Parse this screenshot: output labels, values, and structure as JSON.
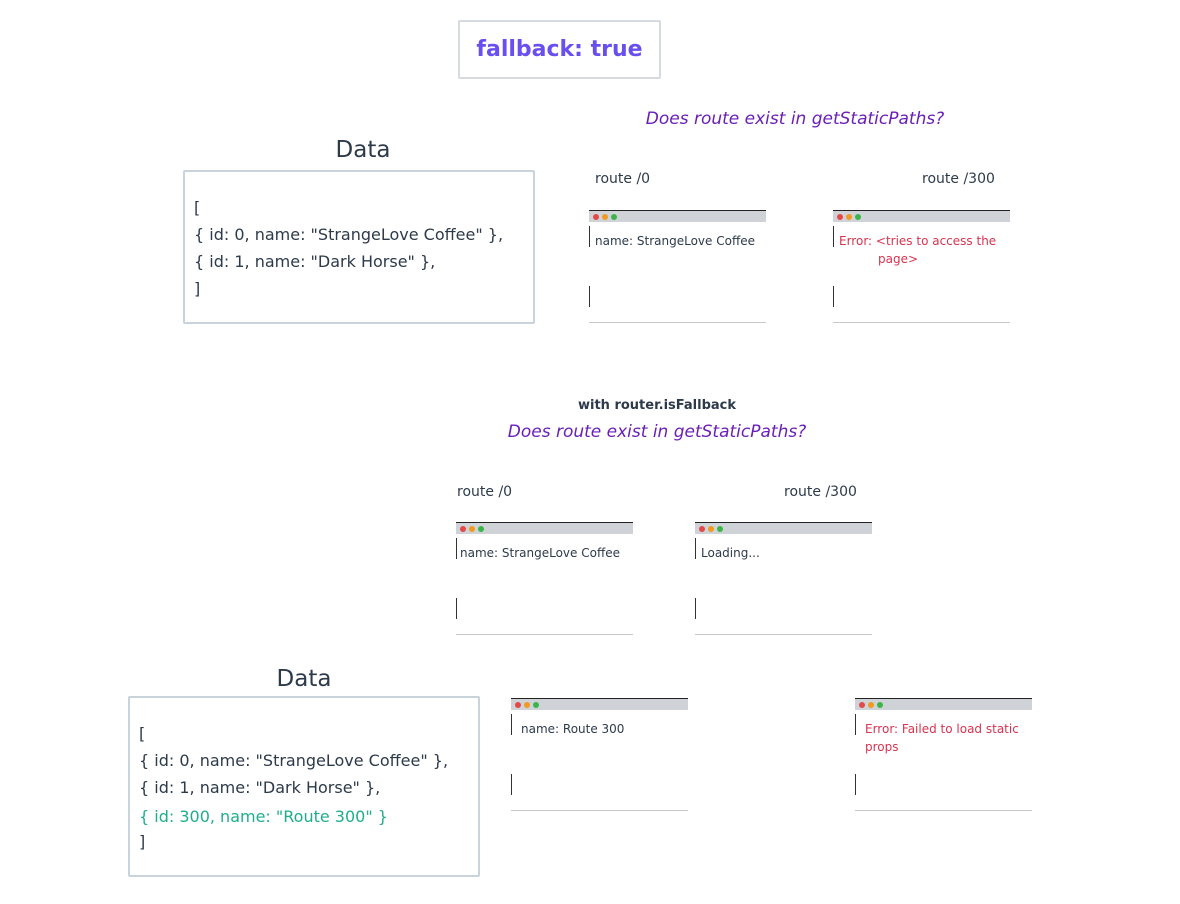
{
  "title": "fallback: true",
  "question": "Does route exist in getStaticPaths?",
  "subtitle": "with router.isFallback",
  "data_title": "Data",
  "data_top": [
    "[",
    "  { id: 0, name: \"StrangeLove Coffee\" },",
    "  { id: 1, name: \"Dark Horse\" },",
    "]"
  ],
  "data_bottom": [
    "[",
    "  { id: 0, name: \"StrangeLove Coffee\" },",
    "  { id: 1, name: \"Dark Horse\" },",
    "  { id: 300, name: \"Route 300\" }",
    "]"
  ],
  "route_0": "route /0",
  "route_300": "route /300",
  "windows": {
    "top_route0": "name: StrangeLove Coffee",
    "top_route300_line1": "Error: <tries to access the",
    "top_route300_line2": "page>",
    "mid_route0": "name: StrangeLove Coffee",
    "mid_route300": "Loading...",
    "bottom_left": "name: Route 300",
    "bottom_right": "Error: Failed to load static props"
  },
  "colors": {
    "title": "#6a4ff0",
    "question": "#6a1fb8",
    "error": "#d8334f",
    "highlight": "#1fae8d",
    "dot_red": "#e64848",
    "dot_orange": "#f09a23",
    "dot_green": "#3bb54a"
  }
}
